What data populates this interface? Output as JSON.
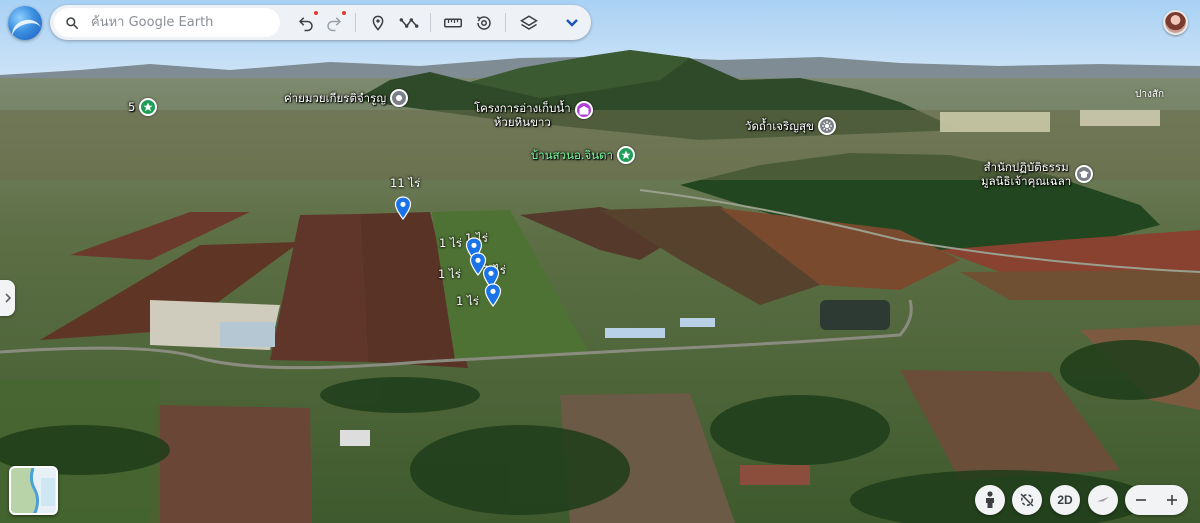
{
  "search": {
    "placeholder": "ค้นหา Google Earth"
  },
  "toolbar_icons": [
    "undo-icon",
    "redo-icon",
    "place-pin-icon",
    "path-icon",
    "ruler-icon",
    "history-icon",
    "layers-icon",
    "chevron-down-icon"
  ],
  "map_labels": {
    "camp": "ค่ายมวยเกียรติจำรูญ",
    "reservoir": "โครงการอ่างเก็บน้ำ\nห้วยหินขาว",
    "temple": "วัดถ้ำเจริญสุข",
    "garden": "บ้านสวนอ.จินดา",
    "dharma_line1": "สำนักปฏิบัติธรรม",
    "dharma_line2": "มูลนิธิเจ้าคุณเฉลา",
    "far_right": "ปางสัก",
    "left_count": "5"
  },
  "pins": {
    "p1": "11 ไร่",
    "p2": "1 ไร่",
    "p3": "1 ไร่",
    "p4": "1 ไร่",
    "p5": "1 ไร่",
    "p6": "1 ไร่"
  },
  "controls": {
    "view_2d": "2D"
  },
  "colors": {
    "pin_blue": "#1a73e8",
    "reservoir_purple": "#b040d8",
    "green_poi": "#1f9e57",
    "gray_poi": "#7b7f86",
    "text_light": "#ffffff"
  }
}
